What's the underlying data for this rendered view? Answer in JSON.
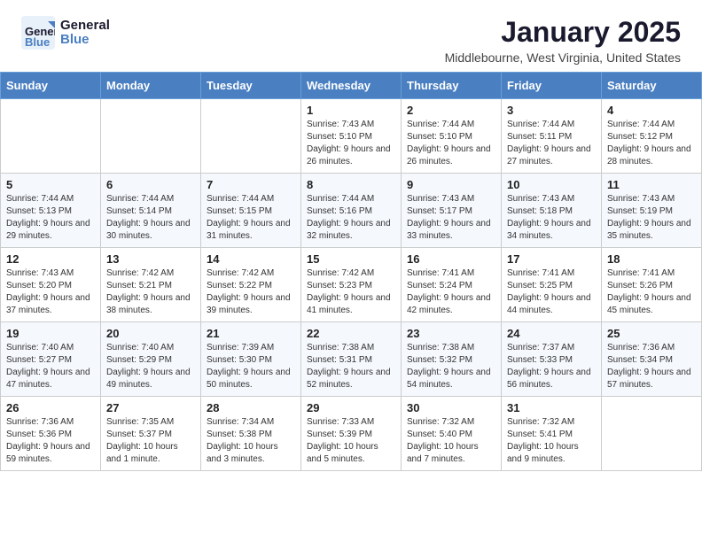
{
  "header": {
    "logo_general": "General",
    "logo_blue": "Blue",
    "month_year": "January 2025",
    "location": "Middlebourne, West Virginia, United States"
  },
  "weekdays": [
    "Sunday",
    "Monday",
    "Tuesday",
    "Wednesday",
    "Thursday",
    "Friday",
    "Saturday"
  ],
  "weeks": [
    [
      {
        "day": "",
        "content": ""
      },
      {
        "day": "",
        "content": ""
      },
      {
        "day": "",
        "content": ""
      },
      {
        "day": "1",
        "content": "Sunrise: 7:43 AM\nSunset: 5:10 PM\nDaylight: 9 hours and 26 minutes."
      },
      {
        "day": "2",
        "content": "Sunrise: 7:44 AM\nSunset: 5:10 PM\nDaylight: 9 hours and 26 minutes."
      },
      {
        "day": "3",
        "content": "Sunrise: 7:44 AM\nSunset: 5:11 PM\nDaylight: 9 hours and 27 minutes."
      },
      {
        "day": "4",
        "content": "Sunrise: 7:44 AM\nSunset: 5:12 PM\nDaylight: 9 hours and 28 minutes."
      }
    ],
    [
      {
        "day": "5",
        "content": "Sunrise: 7:44 AM\nSunset: 5:13 PM\nDaylight: 9 hours and 29 minutes."
      },
      {
        "day": "6",
        "content": "Sunrise: 7:44 AM\nSunset: 5:14 PM\nDaylight: 9 hours and 30 minutes."
      },
      {
        "day": "7",
        "content": "Sunrise: 7:44 AM\nSunset: 5:15 PM\nDaylight: 9 hours and 31 minutes."
      },
      {
        "day": "8",
        "content": "Sunrise: 7:44 AM\nSunset: 5:16 PM\nDaylight: 9 hours and 32 minutes."
      },
      {
        "day": "9",
        "content": "Sunrise: 7:43 AM\nSunset: 5:17 PM\nDaylight: 9 hours and 33 minutes."
      },
      {
        "day": "10",
        "content": "Sunrise: 7:43 AM\nSunset: 5:18 PM\nDaylight: 9 hours and 34 minutes."
      },
      {
        "day": "11",
        "content": "Sunrise: 7:43 AM\nSunset: 5:19 PM\nDaylight: 9 hours and 35 minutes."
      }
    ],
    [
      {
        "day": "12",
        "content": "Sunrise: 7:43 AM\nSunset: 5:20 PM\nDaylight: 9 hours and 37 minutes."
      },
      {
        "day": "13",
        "content": "Sunrise: 7:42 AM\nSunset: 5:21 PM\nDaylight: 9 hours and 38 minutes."
      },
      {
        "day": "14",
        "content": "Sunrise: 7:42 AM\nSunset: 5:22 PM\nDaylight: 9 hours and 39 minutes."
      },
      {
        "day": "15",
        "content": "Sunrise: 7:42 AM\nSunset: 5:23 PM\nDaylight: 9 hours and 41 minutes."
      },
      {
        "day": "16",
        "content": "Sunrise: 7:41 AM\nSunset: 5:24 PM\nDaylight: 9 hours and 42 minutes."
      },
      {
        "day": "17",
        "content": "Sunrise: 7:41 AM\nSunset: 5:25 PM\nDaylight: 9 hours and 44 minutes."
      },
      {
        "day": "18",
        "content": "Sunrise: 7:41 AM\nSunset: 5:26 PM\nDaylight: 9 hours and 45 minutes."
      }
    ],
    [
      {
        "day": "19",
        "content": "Sunrise: 7:40 AM\nSunset: 5:27 PM\nDaylight: 9 hours and 47 minutes."
      },
      {
        "day": "20",
        "content": "Sunrise: 7:40 AM\nSunset: 5:29 PM\nDaylight: 9 hours and 49 minutes."
      },
      {
        "day": "21",
        "content": "Sunrise: 7:39 AM\nSunset: 5:30 PM\nDaylight: 9 hours and 50 minutes."
      },
      {
        "day": "22",
        "content": "Sunrise: 7:38 AM\nSunset: 5:31 PM\nDaylight: 9 hours and 52 minutes."
      },
      {
        "day": "23",
        "content": "Sunrise: 7:38 AM\nSunset: 5:32 PM\nDaylight: 9 hours and 54 minutes."
      },
      {
        "day": "24",
        "content": "Sunrise: 7:37 AM\nSunset: 5:33 PM\nDaylight: 9 hours and 56 minutes."
      },
      {
        "day": "25",
        "content": "Sunrise: 7:36 AM\nSunset: 5:34 PM\nDaylight: 9 hours and 57 minutes."
      }
    ],
    [
      {
        "day": "26",
        "content": "Sunrise: 7:36 AM\nSunset: 5:36 PM\nDaylight: 9 hours and 59 minutes."
      },
      {
        "day": "27",
        "content": "Sunrise: 7:35 AM\nSunset: 5:37 PM\nDaylight: 10 hours and 1 minute."
      },
      {
        "day": "28",
        "content": "Sunrise: 7:34 AM\nSunset: 5:38 PM\nDaylight: 10 hours and 3 minutes."
      },
      {
        "day": "29",
        "content": "Sunrise: 7:33 AM\nSunset: 5:39 PM\nDaylight: 10 hours and 5 minutes."
      },
      {
        "day": "30",
        "content": "Sunrise: 7:32 AM\nSunset: 5:40 PM\nDaylight: 10 hours and 7 minutes."
      },
      {
        "day": "31",
        "content": "Sunrise: 7:32 AM\nSunset: 5:41 PM\nDaylight: 10 hours and 9 minutes."
      },
      {
        "day": "",
        "content": ""
      }
    ]
  ]
}
